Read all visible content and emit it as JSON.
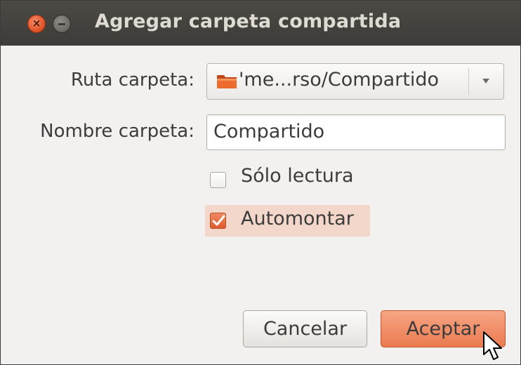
{
  "window": {
    "title": "Agregar carpeta compartida",
    "close_symbol": "×",
    "accent_color": "#e8643a",
    "titlebar_color": "#3d3c38"
  },
  "form": {
    "ruta_label": "Ruta carpeta:",
    "ruta_value": "'me...rso/Compartido",
    "ruta_icon": "folder-icon",
    "nombre_label": "Nombre carpeta:",
    "nombre_value": "Compartido"
  },
  "options": {
    "readonly_label": "Sólo lectura",
    "readonly_checked": false,
    "automount_label": "Automontar",
    "automount_checked": true
  },
  "buttons": {
    "cancel_label": "Cancelar",
    "accept_label": "Aceptar"
  }
}
